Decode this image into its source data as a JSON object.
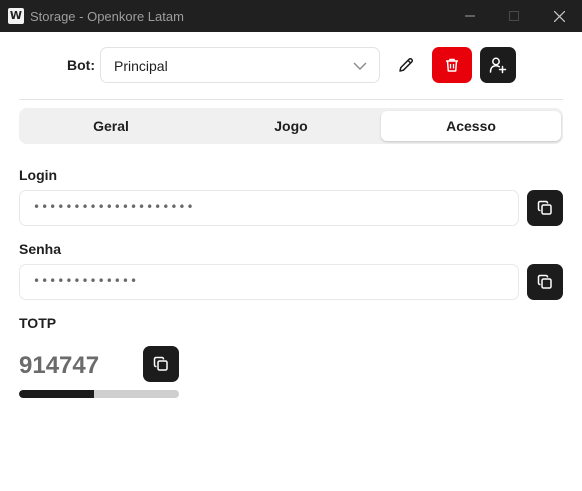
{
  "window": {
    "app_icon_letter": "W",
    "title": "Storage - Openkore Latam"
  },
  "bot": {
    "label": "Bot:",
    "selected": "Principal",
    "actions": {
      "edit_icon": "pencil-icon",
      "delete_icon": "trash-icon",
      "add_icon": "user-plus-icon"
    },
    "colors": {
      "delete": "#e8000b",
      "dark": "#1c1c1c"
    }
  },
  "tabs": [
    {
      "label": "Geral",
      "active": false
    },
    {
      "label": "Jogo",
      "active": false
    },
    {
      "label": "Acesso",
      "active": true
    }
  ],
  "access": {
    "login": {
      "label": "Login",
      "value": "••••••••••••••••••••"
    },
    "password": {
      "label": "Senha",
      "value": "•••••••••••••"
    },
    "totp": {
      "label": "TOTP",
      "code": "914747",
      "progress": 0.47
    }
  }
}
